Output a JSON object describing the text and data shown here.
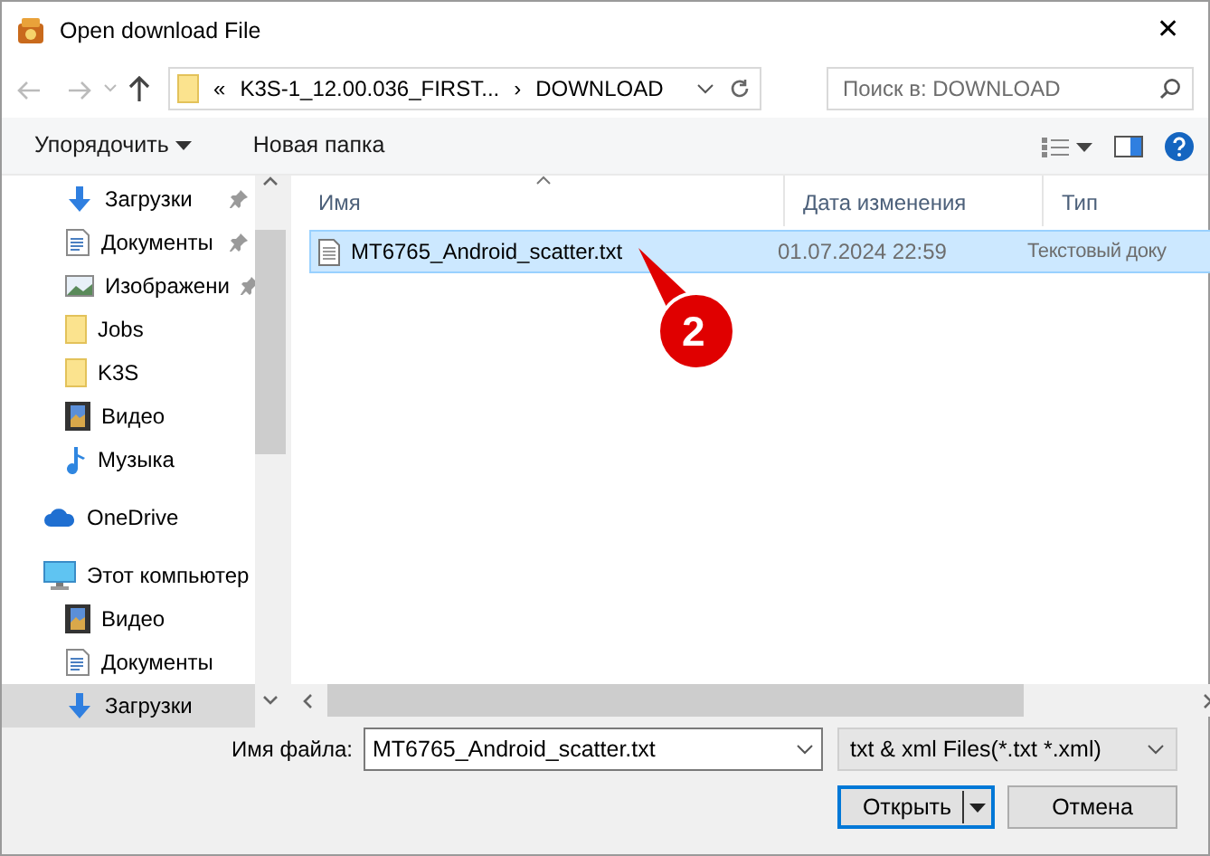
{
  "window": {
    "title": "Open download File",
    "close": "✕"
  },
  "address_bar": {
    "prefix": "«",
    "segments": [
      "K3S-1_12.00.036_FIRST...",
      "DOWNLOAD"
    ],
    "separator": "›"
  },
  "search": {
    "placeholder": "Поиск в: DOWNLOAD"
  },
  "toolbar": {
    "organize": "Упорядочить",
    "new_folder": "Новая папка"
  },
  "sidebar": {
    "quick_access": [
      {
        "label": "Загрузки",
        "kind": "downloads",
        "pinned": true,
        "selected": false
      },
      {
        "label": "Документы",
        "kind": "documents",
        "pinned": true,
        "selected": false
      },
      {
        "label": "Изображени",
        "kind": "pictures",
        "pinned": true,
        "selected": false
      },
      {
        "label": "Jobs",
        "kind": "folder",
        "pinned": false,
        "selected": false
      },
      {
        "label": "K3S",
        "kind": "folder",
        "pinned": false,
        "selected": false
      },
      {
        "label": "Видео",
        "kind": "video",
        "pinned": false,
        "selected": false
      },
      {
        "label": "Музыка",
        "kind": "music",
        "pinned": false,
        "selected": false
      }
    ],
    "items": [
      {
        "label": "OneDrive",
        "kind": "cloud",
        "selected": false
      },
      {
        "label": "Этот компьютер",
        "kind": "computer",
        "selected": false,
        "children": [
          {
            "label": "Видео",
            "kind": "video",
            "selected": false
          },
          {
            "label": "Документы",
            "kind": "documents",
            "selected": false
          },
          {
            "label": "Загрузки",
            "kind": "downloads",
            "selected": true
          }
        ]
      }
    ]
  },
  "file_list": {
    "columns": [
      "Имя",
      "Дата изменения",
      "Тип"
    ],
    "rows": [
      {
        "name": "MT6765_Android_scatter.txt",
        "date": "01.07.2024 22:59",
        "type": "Текстовый доку",
        "selected": true
      }
    ]
  },
  "callout": {
    "number": "2"
  },
  "footer": {
    "filename_label": "Имя файла:",
    "filename": "MT6765_Android_scatter.txt",
    "filter": "txt & xml Files(*.txt *.xml)",
    "open": "Открыть",
    "cancel": "Отмена"
  }
}
